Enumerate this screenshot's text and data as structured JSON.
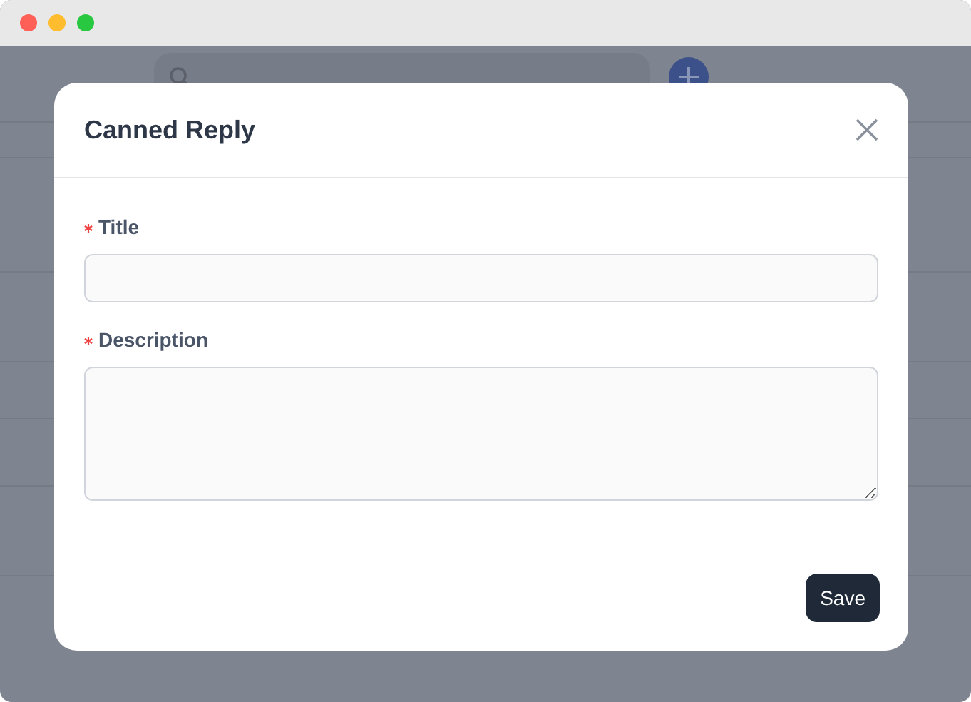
{
  "dialog": {
    "title": "Canned Reply",
    "fields": [
      {
        "kind": "input",
        "label": "Title",
        "required": true
      },
      {
        "kind": "textarea",
        "label": "Description",
        "required": true
      }
    ],
    "buttons": [
      "Save"
    ]
  }
}
